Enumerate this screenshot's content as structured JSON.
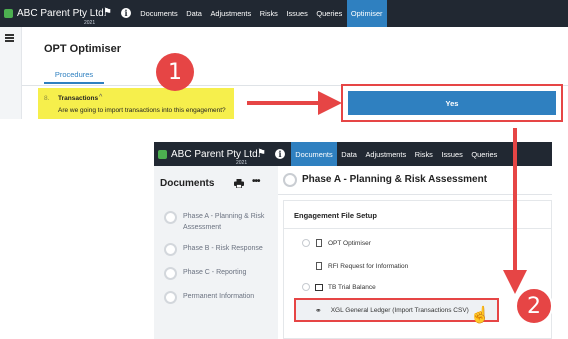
{
  "window1": {
    "brand": "ABC Parent Pty Ltd.",
    "year": "2021",
    "nav": [
      "Documents",
      "Data",
      "Adjustments",
      "Risks",
      "Issues",
      "Queries",
      "Optimiser"
    ],
    "active_nav": "Optimiser",
    "page_title": "OPT Optimiser",
    "tab": "Procedures",
    "procedure": {
      "number": "8.",
      "label": "Transactions",
      "chevron": "^",
      "question": "Are we going to import transactions into this engagement?"
    },
    "yes_button": "Yes"
  },
  "annotations": {
    "step1": "1",
    "step2": "2",
    "accent_red": "#e64545",
    "highlight_yellow": "#f6ef4c"
  },
  "window2": {
    "brand": "ABC Parent Pty Ltd.",
    "year": "2021",
    "nav": [
      "Documents",
      "Data",
      "Adjustments",
      "Risks",
      "Issues",
      "Queries"
    ],
    "active_nav": "Documents",
    "sidebar_title": "Documents",
    "phases": [
      "Phase A - Planning & Risk Assessment",
      "Phase B - Risk Response",
      "Phase C - Reporting",
      "Permanent Information"
    ],
    "main_title": "Phase A - Planning & Risk Assessment",
    "section_title": "Engagement File Setup",
    "rows": [
      "OPT Optimiser",
      "RFI Request for Information",
      "TB Trial Balance",
      "XGL General Ledger (Import Transactions CSV)"
    ]
  },
  "colors": {
    "topbar": "#212832",
    "active_blue": "#2f80c0"
  }
}
